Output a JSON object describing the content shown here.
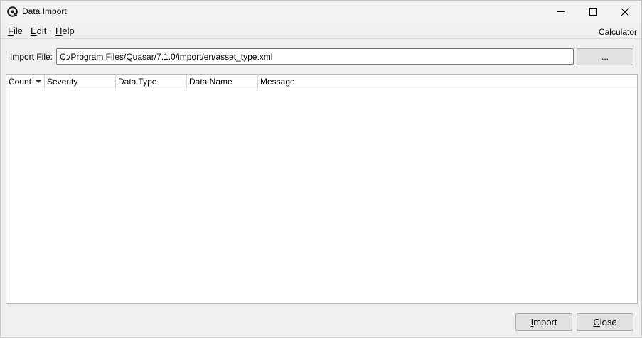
{
  "window": {
    "title": "Data Import",
    "controls": {
      "minimize_icon": "minimize-icon",
      "maximize_icon": "maximize-icon",
      "close_icon": "close-icon"
    }
  },
  "menu": {
    "file": {
      "accel": "F",
      "rest": "ile"
    },
    "edit": {
      "accel": "E",
      "rest": "dit"
    },
    "help": {
      "accel": "H",
      "rest": "elp"
    },
    "calculator": "Calculator"
  },
  "import": {
    "label": "Import File:",
    "value": "C:/Program Files/Quasar/7.1.0/import/en/asset_type.xml",
    "browse_label": "..."
  },
  "table": {
    "columns": [
      "Count",
      "Severity",
      "Data Type",
      "Data Name",
      "Message"
    ],
    "sorted_column": "Count",
    "rows": []
  },
  "footer": {
    "import": {
      "accel": "I",
      "rest": "mport"
    },
    "close": {
      "accel": "C",
      "rest": "lose"
    }
  },
  "colors": {
    "window_bg": "#f0f0f0",
    "table_bg": "#ffffff",
    "button_bg": "#e1e1e1"
  }
}
